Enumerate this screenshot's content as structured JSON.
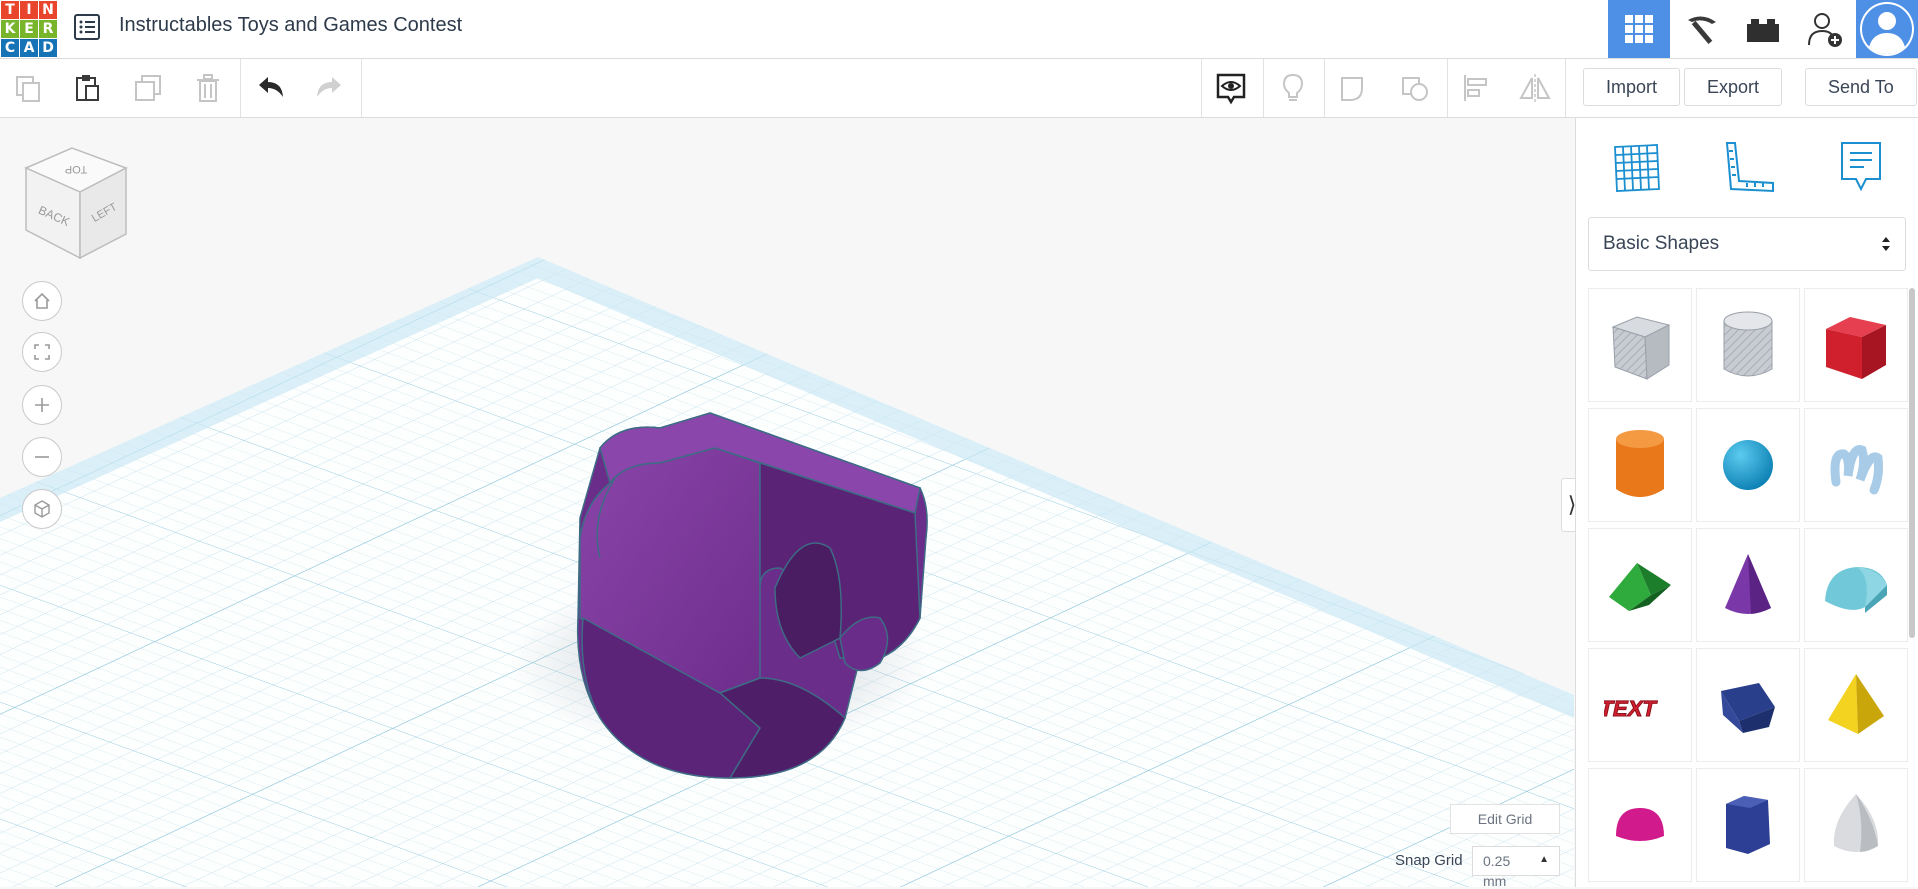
{
  "app": {
    "logo_letters": [
      "T",
      "I",
      "N",
      "K",
      "E",
      "R",
      "C",
      "A",
      "D"
    ],
    "logo_colors": [
      "#e8452c",
      "#e8452c",
      "#e8452c",
      "#79b52a",
      "#79b52a",
      "#79b52a",
      "#1673b5",
      "#1673b5",
      "#1673b5"
    ],
    "project_title": "Instructables Toys and Games Contest"
  },
  "topbar": {
    "icons": [
      "design-grid-icon",
      "pickaxe-icon",
      "bricks-icon",
      "add-user-icon",
      "avatar"
    ],
    "accent": "#4d90e6"
  },
  "toolbar": {
    "left_tools": [
      "copy-icon",
      "paste-icon",
      "duplicate-icon",
      "delete-icon",
      "undo-icon",
      "redo-icon"
    ],
    "right_tools": [
      "visibility-icon",
      "light-bulb-icon",
      "group-icon",
      "ungroup-icon",
      "align-icon",
      "mirror-icon"
    ],
    "import_label": "Import",
    "export_label": "Export",
    "send_to_label": "Send To"
  },
  "viewcube": {
    "top": "TOP",
    "back": "BACK",
    "left": "LEFT"
  },
  "side_panel": {
    "tools": [
      "workplane-icon",
      "ruler-icon",
      "notes-icon"
    ],
    "category": "Basic Shapes",
    "shapes": [
      "Box",
      "Cylinder",
      "Box",
      "Cylinder",
      "Sphere",
      "Scribble",
      "Roof",
      "Cone",
      "Round Roof",
      "Text",
      "Wedge",
      "Pyramid",
      "Half Sphere",
      "Polygon",
      "Paraboloid"
    ]
  },
  "grid": {
    "edit_grid_label": "Edit Grid",
    "snap_grid_label": "Snap Grid",
    "snap_value": "0.25",
    "snap_unit": "mm"
  }
}
